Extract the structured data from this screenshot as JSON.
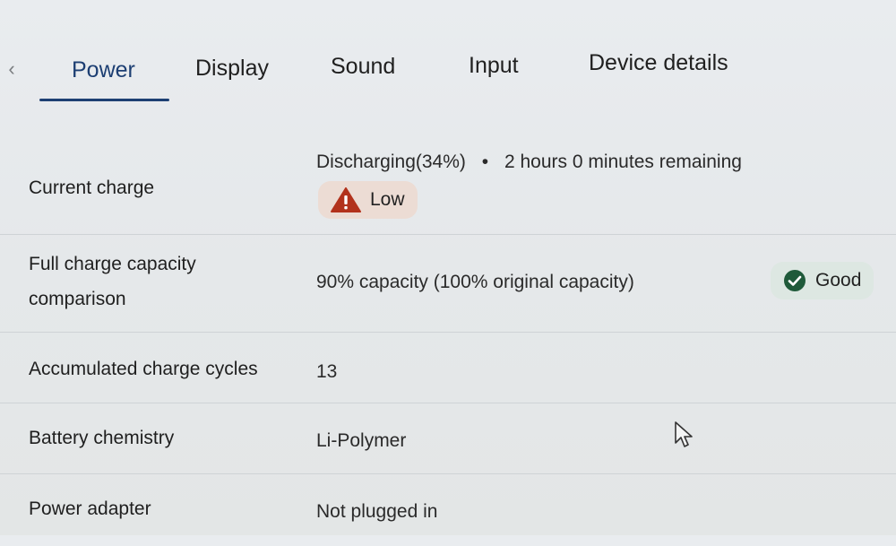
{
  "tabs": [
    {
      "label": "Power",
      "active": true
    },
    {
      "label": "Display",
      "active": false
    },
    {
      "label": "Sound",
      "active": false
    },
    {
      "label": "Input",
      "active": false
    },
    {
      "label": "Device details",
      "active": false
    }
  ],
  "rows": {
    "current_charge": {
      "label": "Current charge",
      "status": "Discharging(34%)",
      "separator": "•",
      "remaining": "2 hours 0 minutes remaining",
      "badge": {
        "label": "Low",
        "icon": "warning-triangle-icon",
        "color": "#b2321c"
      }
    },
    "full_capacity": {
      "label_line1": "Full charge capacity",
      "label_line2": "comparison",
      "value": "90% capacity (100% original capacity)",
      "badge": {
        "label": "Good",
        "icon": "check-circle-icon",
        "color": "#1f5a3a"
      }
    },
    "charge_cycles": {
      "label": "Accumulated charge cycles",
      "value": "13"
    },
    "chemistry": {
      "label": "Battery chemistry",
      "value": "Li-Polymer"
    },
    "power_adapter": {
      "label": "Power adapter",
      "value": "Not plugged in"
    }
  },
  "colors": {
    "accent": "#1d3f73",
    "background": "#e7eaec",
    "divider": "#cfd3d6"
  }
}
